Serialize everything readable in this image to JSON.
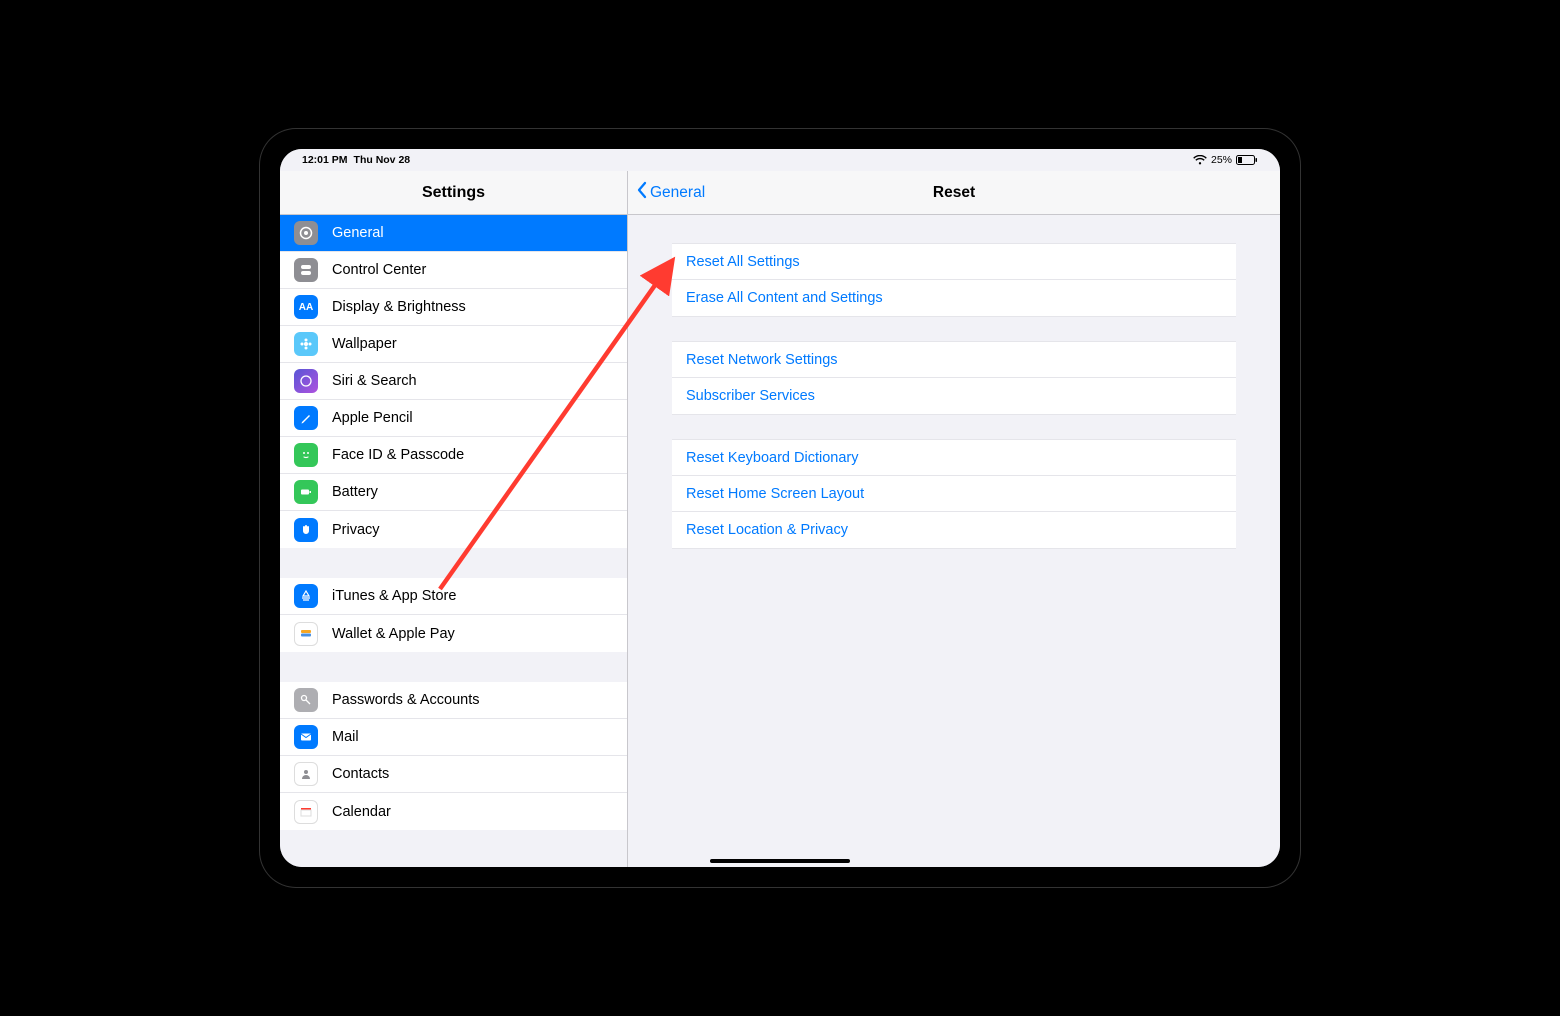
{
  "status": {
    "time": "12:01 PM",
    "date": "Thu Nov 28",
    "battery_percent": "25%"
  },
  "sidebar": {
    "title": "Settings",
    "group1": [
      {
        "label": "General",
        "icon": "gear"
      },
      {
        "label": "Control Center",
        "icon": "sliders"
      },
      {
        "label": "Display & Brightness",
        "icon": "aa"
      },
      {
        "label": "Wallpaper",
        "icon": "flower"
      },
      {
        "label": "Siri & Search",
        "icon": "siri"
      },
      {
        "label": "Apple Pencil",
        "icon": "pencil"
      },
      {
        "label": "Face ID & Passcode",
        "icon": "face"
      },
      {
        "label": "Battery",
        "icon": "battery"
      },
      {
        "label": "Privacy",
        "icon": "hand"
      }
    ],
    "group2": [
      {
        "label": "iTunes & App Store",
        "icon": "appstore"
      },
      {
        "label": "Wallet & Apple Pay",
        "icon": "wallet"
      }
    ],
    "group3": [
      {
        "label": "Passwords & Accounts",
        "icon": "key"
      },
      {
        "label": "Mail",
        "icon": "mail"
      },
      {
        "label": "Contacts",
        "icon": "contacts"
      },
      {
        "label": "Calendar",
        "icon": "calendar"
      }
    ]
  },
  "detail": {
    "back_label": "General",
    "title": "Reset",
    "groups": [
      [
        "Reset All Settings",
        "Erase All Content and Settings"
      ],
      [
        "Reset Network Settings",
        "Subscriber Services"
      ],
      [
        "Reset Keyboard Dictionary",
        "Reset Home Screen Layout",
        "Reset Location & Privacy"
      ]
    ]
  }
}
